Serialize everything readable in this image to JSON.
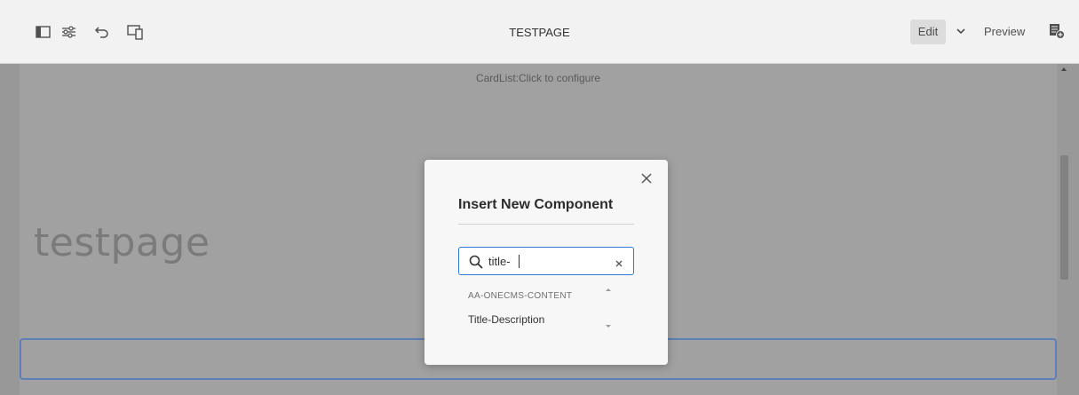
{
  "toolbar": {
    "title": "TESTPAGE",
    "edit_label": "Edit",
    "preview_label": "Preview",
    "icons": [
      "side-panel-icon",
      "page-properties-icon",
      "undo-icon",
      "emulator-icon",
      "chevron-down-icon",
      "page-info-icon"
    ]
  },
  "canvas": {
    "cardlist_placeholder": "CardList:Click to configure",
    "heading": "testpage"
  },
  "dialog": {
    "title": "Insert New Component",
    "search": {
      "value": "title-",
      "placeholder": ""
    },
    "groups": [
      {
        "label": "AA-ONECMS-CONTENT",
        "items": [
          "Title-Description"
        ]
      }
    ]
  },
  "colors": {
    "accent": "#2d7dd2",
    "selection_outline": "#5b7fb6",
    "overlay": "#a1a1a1"
  }
}
